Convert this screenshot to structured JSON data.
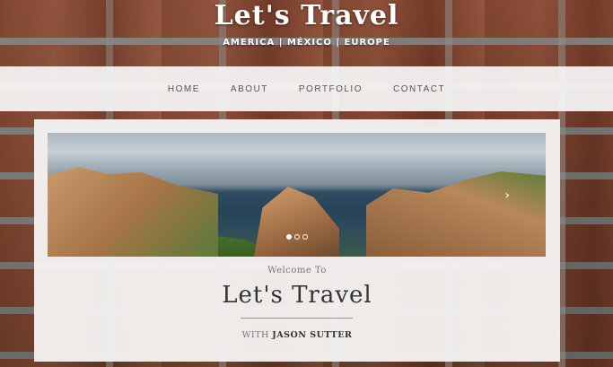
{
  "header": {
    "title": "Let's Travel",
    "subtitle": "AMERICA | MÉXICO | EUROPE"
  },
  "nav": {
    "items": [
      {
        "label": "HOME"
      },
      {
        "label": "ABOUT"
      },
      {
        "label": "PORTFOLIO"
      },
      {
        "label": "CONTACT"
      }
    ]
  },
  "slider": {
    "next_icon": "chevron-right-icon",
    "next_glyph": "›",
    "dots": 3,
    "active_dot": 1
  },
  "content": {
    "welcome": "Welcome To",
    "title": "Let's Travel",
    "with_prefix": "WITH",
    "author": "JASON SUTTER"
  },
  "colors": {
    "nav_bg": "#f6f6f6",
    "panel_bg": "#f6f4f3",
    "title_text": "#333333",
    "header_text": "#ffffff"
  }
}
